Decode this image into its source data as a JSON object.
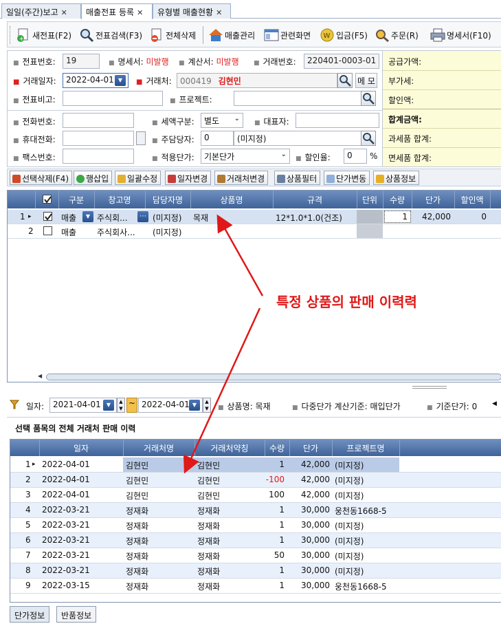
{
  "tabs": [
    {
      "label": "일일(주간)보고"
    },
    {
      "label": "매출전표 등록"
    },
    {
      "label": "유형별 매출현황"
    }
  ],
  "toolbar": {
    "new": "새전표(F2)",
    "search": "전표검색(F3)",
    "delete_all": "전체삭제",
    "sales_manage": "매출관리",
    "related_screen": "관련화면",
    "deposit": "입금(F5)",
    "order": "주문(R)",
    "statement": "명세서(F10)"
  },
  "form": {
    "slip_no_label": "전표번호:",
    "slip_no": "19",
    "statement_label": "명세서:",
    "statement_value": "미발행",
    "invoice_label": "계산서:",
    "invoice_value": "미발행",
    "trade_no_label": "거래번호:",
    "trade_no": "220401-0003-01",
    "trade_date_label": "거래일자:",
    "trade_date": "2022-04-01",
    "client_label": "거래처:",
    "client_code": "000419",
    "client_name": "김현민",
    "memo_label": "메 모",
    "remark_label": "전표비고:",
    "project_label": "프로젝트:",
    "phone_label": "전화번호:",
    "tax_type_label": "세액구분:",
    "tax_type": "별도",
    "ceo_label": "대표자:",
    "mobile_label": "휴대전화:",
    "manager_label": "주담당자:",
    "manager_code": "0",
    "manager_name": "(미지정)",
    "fax_label": "팩스번호:",
    "price_type_label": "적용단가:",
    "price_type": "기본단가",
    "discount_label": "할인율:",
    "discount": "0",
    "percent": "%"
  },
  "summary": {
    "supply": "공급가액:",
    "vat": "부가세:",
    "discount": "할인액:",
    "total": "합계금액:",
    "taxable": "과세품 합계:",
    "taxfree": "면세품 합계:"
  },
  "buttons": {
    "delete_selected": "선택삭제(F4)",
    "insert_row": "행삽입",
    "bulk_edit": "일괄수정",
    "date_change": "일자변경",
    "client_change": "거래처변경",
    "product_filter": "상품필터",
    "price_change": "단가변동",
    "product_info": "상품정보"
  },
  "grid1": {
    "headers": [
      "구분",
      "창고명",
      "담당자명",
      "상품명",
      "규격",
      "단위",
      "수량",
      "단가",
      "할인액"
    ],
    "rows": [
      {
        "no": "1",
        "type": "매출",
        "warehouse": "주식회...",
        "manager": "(미지정)",
        "product": "목재",
        "spec": "12*1.0*1.0(건조)",
        "unit": "",
        "qty": "1",
        "price": "42,000",
        "discount": "0"
      },
      {
        "no": "2",
        "type": "매출",
        "warehouse": "주식회사...",
        "manager": "(미지정)",
        "product": "",
        "spec": "",
        "unit": "",
        "qty": "",
        "price": "",
        "discount": ""
      }
    ]
  },
  "annotation": "특정 상품의 판매 이력력",
  "filter": {
    "date_label": "일자:",
    "date_from": "2021-04-01",
    "date_to": "2022-04-01",
    "product_label": "상품명:",
    "product": "목재",
    "multi_price_label": "다중단가 계산기준:",
    "multi_price": "매입단가",
    "base_price_label": "기준단가:",
    "base_price": "0"
  },
  "history_title": "선택 품목의 전체 거래처 판매 이력",
  "grid2": {
    "headers": [
      "일자",
      "거래처명",
      "거래처약칭",
      "수량",
      "단가",
      "프로젝트명"
    ],
    "rows": [
      {
        "no": "1",
        "date": "2022-04-01",
        "client": "김현민",
        "alias": "김현민",
        "qty": "1",
        "price": "42,000",
        "project": "(미지정)"
      },
      {
        "no": "2",
        "date": "2022-04-01",
        "client": "김현민",
        "alias": "김현민",
        "qty": "-100",
        "price": "42,000",
        "project": "(미지정)"
      },
      {
        "no": "3",
        "date": "2022-04-01",
        "client": "김현민",
        "alias": "김현민",
        "qty": "100",
        "price": "42,000",
        "project": "(미지정)"
      },
      {
        "no": "4",
        "date": "2022-03-21",
        "client": "정재화",
        "alias": "정재화",
        "qty": "1",
        "price": "30,000",
        "project": "웅천동1668-5"
      },
      {
        "no": "5",
        "date": "2022-03-21",
        "client": "정재화",
        "alias": "정재화",
        "qty": "1",
        "price": "30,000",
        "project": "(미지정)"
      },
      {
        "no": "6",
        "date": "2022-03-21",
        "client": "정재화",
        "alias": "정재화",
        "qty": "1",
        "price": "30,000",
        "project": "(미지정)"
      },
      {
        "no": "7",
        "date": "2022-03-21",
        "client": "정재화",
        "alias": "정재화",
        "qty": "50",
        "price": "30,000",
        "project": "(미지정)"
      },
      {
        "no": "8",
        "date": "2022-03-21",
        "client": "정재화",
        "alias": "정재화",
        "qty": "1",
        "price": "30,000",
        "project": "(미지정)"
      },
      {
        "no": "9",
        "date": "2022-03-15",
        "client": "정재화",
        "alias": "정재화",
        "qty": "1",
        "price": "30,000",
        "project": "웅천동1668-5"
      }
    ]
  },
  "bottom_tabs": [
    "단가정보",
    "반품정보"
  ],
  "colors": {
    "accent_red": "#e01818",
    "header_blue": "#3f6399",
    "summary_yellow": "#fdfcd9"
  }
}
